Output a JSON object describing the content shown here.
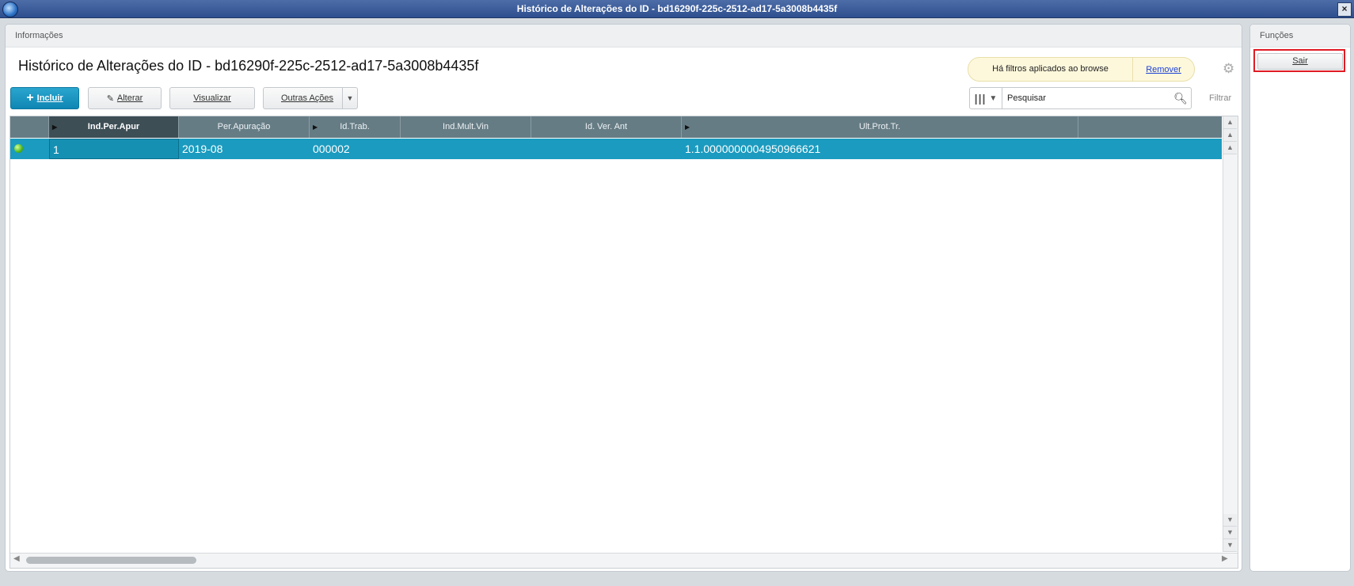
{
  "window": {
    "title": "Histórico de Alterações do ID - bd16290f-225c-2512-ad17-5a3008b4435f",
    "close_label": "×"
  },
  "main": {
    "panel_title": "Informações",
    "page_title": "Histórico de Alterações do ID - bd16290f-225c-2512-ad17-5a3008b4435f",
    "filter_notice": "Há filtros aplicados ao browse",
    "filter_remove": "Remover",
    "toolbar": {
      "incluir": "Incluir",
      "alterar": "Alterar",
      "visualizar": "Visualizar",
      "outras_acoes": "Outras Ações"
    },
    "search": {
      "placeholder": "Pesquisar",
      "value": "Pesquisar"
    },
    "filtrar": "Filtrar",
    "grid": {
      "columns": [
        "Ind.Per.Apur",
        "Per.Apuração",
        "Id.Trab.",
        "Ind.Mult.Vin",
        "Id. Ver. Ant",
        "Ult.Prot.Tr."
      ],
      "rows": [
        {
          "status": "green",
          "cells": [
            "1",
            "2019-08",
            "000002",
            "",
            "",
            "1.1.0000000004950966621"
          ]
        }
      ]
    }
  },
  "side": {
    "panel_title": "Funções",
    "sair": "Sair"
  },
  "icons": {
    "app": "app-logo-icon",
    "settings": "gear-icon",
    "search": "search-icon",
    "columns": "columns-icon"
  },
  "colors": {
    "selected_row": "#1b9bbf",
    "primary_button": "#1a97c4",
    "header": "#667c85",
    "highlight": "#e01b24"
  }
}
